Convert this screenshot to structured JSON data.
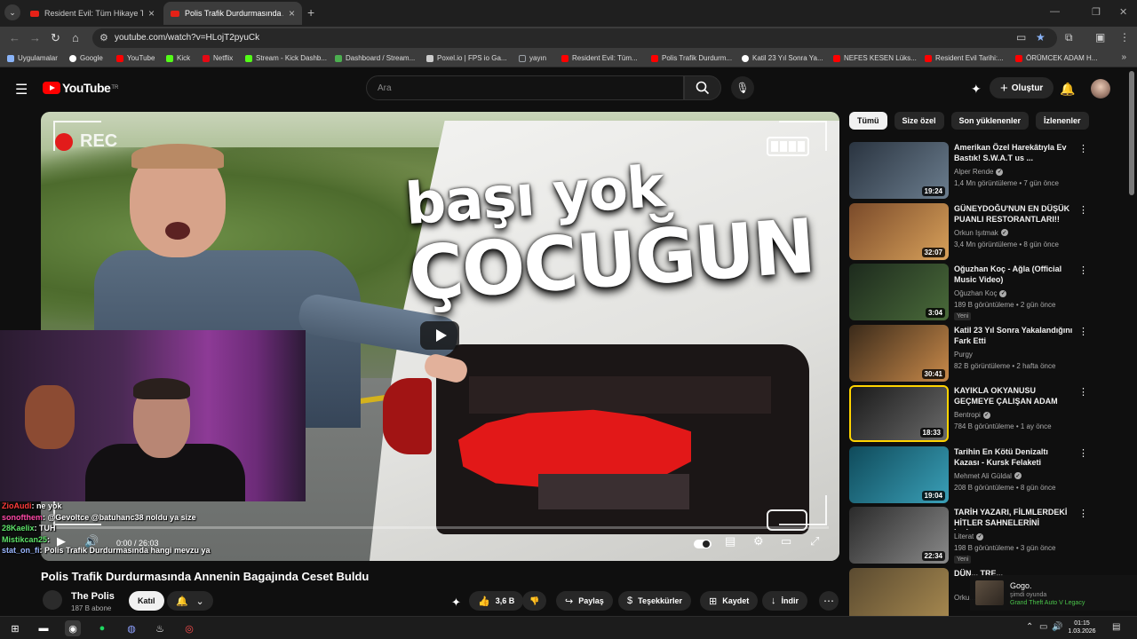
{
  "browser": {
    "tabs": [
      {
        "title": "Resident Evil: Tüm Hikaye Türkçe",
        "active": false
      },
      {
        "title": "Polis Trafik Durdurmasında Annenin",
        "active": true
      }
    ],
    "url": "youtube.com/watch?v=HLojT2pyuCk",
    "bookmarks": [
      {
        "label": "Uygulamalar",
        "color": "#8ab4f8"
      },
      {
        "label": "Google",
        "color": "#ffffff"
      },
      {
        "label": "YouTube",
        "color": "#ff0000"
      },
      {
        "label": "Kick",
        "color": "#53fc18"
      },
      {
        "label": "Netflix",
        "color": "#e50914"
      },
      {
        "label": "Stream - Kick Dashb...",
        "color": "#53fc18"
      },
      {
        "label": "Dashboard / Stream...",
        "color": "#4caf50"
      },
      {
        "label": "Poxel.io | FPS io Ga...",
        "color": "#cccccc"
      },
      {
        "label": "yayın",
        "color": "#9aa0a6"
      },
      {
        "label": "Resident Evil: Tüm...",
        "color": "#ff0000"
      },
      {
        "label": "Polis Trafik Durdurm...",
        "color": "#ff0000"
      },
      {
        "label": "Katil 23 Yıl Sonra Ya...",
        "color": "#ffffff"
      },
      {
        "label": "NEFES KESEN Lüks...",
        "color": "#ff0000"
      },
      {
        "label": "Resident Evil Tarihi:...",
        "color": "#ff0000"
      },
      {
        "label": "ÖRÜMCEK ADAM H...",
        "color": "#ff0000"
      }
    ]
  },
  "youtube": {
    "logo_text": "YouTube",
    "logo_sup": "TR",
    "search_placeholder": "Ara",
    "create_label": "Oluştur"
  },
  "player": {
    "thumbnail_text_top": "başı yok",
    "thumbnail_text_bottom": "ÇOCUĞUN",
    "rec_label": "REC",
    "time": "0:00 / 26:03",
    "progress": 0
  },
  "webcam_chat": [
    {
      "user": "ZioAudi",
      "color": "#ff3b3b",
      "text": ": ne yok"
    },
    {
      "user": "sonofthem",
      "color": "#ff4aa8",
      "text": ": @Gevoltce @batuhanc38 noldu ya size"
    },
    {
      "user": "28Kaelix",
      "color": "#5ee36a",
      "text": ": TUH"
    },
    {
      "user": "Mistikcan25",
      "color": "#5ee36a",
      "text": ":"
    },
    {
      "user": "stat_on_fi",
      "color": "#9bb7ff",
      "text": ": Polis Trafik Durdurmasında hangi mevzu ya"
    }
  ],
  "video": {
    "title": "Polis Trafik Durdurmasında Annenin Bagajında Ceset Buldu",
    "channel": "The Polis",
    "subscribers": "187 B abone",
    "join_label": "Katıl",
    "likes": "3,6 B",
    "share_label": "Paylaş",
    "thanks_label": "Teşekkürler",
    "save_label": "Kaydet",
    "download_label": "İndir"
  },
  "chips": [
    "Tümü",
    "Size özel",
    "Son yüklenenler",
    "İzlenenler"
  ],
  "recommendations": [
    {
      "title": "Amerikan Özel Harekâtıyla Ev Bastık! S.W.A.T us ...",
      "channel": "Alper Rende",
      "verified": true,
      "meta": "1,4 Mn görüntüleme • 7 gün önce",
      "duration": "19:24",
      "badge": "",
      "thumb": [
        "#2a3440",
        "#6b7d8e"
      ],
      "selected": false
    },
    {
      "title": "GÜNEYDOĞU'NUN EN DÜŞÜK PUANLI RESTORANTLARI!!",
      "channel": "Orkun Işıtmak",
      "verified": true,
      "meta": "3,4 Mn görüntüleme • 8 gün önce",
      "duration": "32:07",
      "badge": "",
      "thumb": [
        "#7a4a2a",
        "#d8a15a"
      ],
      "selected": false
    },
    {
      "title": "Oğuzhan Koç - Ağla (Official Music Video)",
      "channel": "Oğuzhan Koç",
      "verified": true,
      "meta": "189 B görüntüleme • 2 gün önce",
      "duration": "3:04",
      "badge": "Yeni",
      "thumb": [
        "#1d2a1d",
        "#4a6b3a"
      ],
      "selected": false
    },
    {
      "title": "Katil 23 Yıl Sonra Yakalandığını Fark Etti",
      "channel": "Purgy",
      "verified": false,
      "meta": "82 B görüntüleme • 2 hafta önce",
      "duration": "30:41",
      "badge": "",
      "thumb": [
        "#3a2a1a",
        "#c98a4a"
      ],
      "selected": false
    },
    {
      "title": "KAYIKLA OKYANUSU GEÇMEYE ÇALIŞAN ADAM",
      "channel": "Bentropi",
      "verified": true,
      "meta": "784 B görüntüleme • 1 ay önce",
      "duration": "18:33",
      "badge": "",
      "thumb": [
        "#1a1a1a",
        "#6a6a6a"
      ],
      "selected": true
    },
    {
      "title": "Tarihin En Kötü Denizaltı Kazası - Kursk Felaketi",
      "channel": "Mehmet Ali Güldal",
      "verified": true,
      "meta": "208 B görüntüleme • 8 gün önce",
      "duration": "19:04",
      "badge": "",
      "thumb": [
        "#0f4a5a",
        "#3aa0b8"
      ],
      "selected": false
    },
    {
      "title": "TARİH YAZARI, FİLMLERDEKİ HİTLER SAHNELERİNİ İZLİYOR!",
      "channel": "Literat",
      "verified": true,
      "meta": "198 B görüntüleme • 3 gün önce",
      "duration": "22:34",
      "badge": "Yeni",
      "thumb": [
        "#2a2a2a",
        "#8a8a8a"
      ],
      "selected": false
    },
    {
      "title": "DÜN... TRE...",
      "channel": "Orku...",
      "verified": false,
      "meta": "",
      "duration": "",
      "badge": "",
      "thumb": [
        "#5a4a30",
        "#a88a50"
      ],
      "selected": false
    }
  ],
  "game_overlay": {
    "line1": "Gogo.",
    "line2": "şimdi oyunda",
    "line3": "Grand Theft Auto V Legacy"
  },
  "taskbar": {
    "time": "01:15",
    "date": "1.03.2026"
  }
}
